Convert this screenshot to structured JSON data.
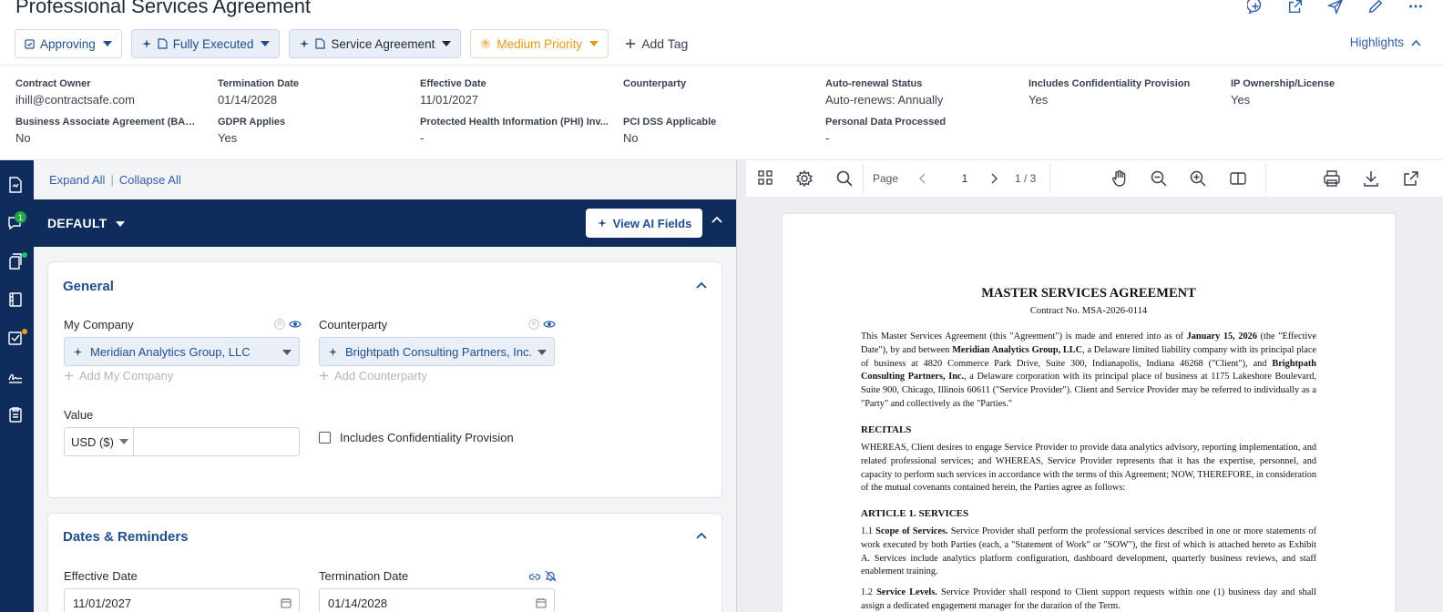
{
  "header": {
    "title": "Professional Services Agreement",
    "chips": {
      "status": "Approving",
      "execution": "Fully Executed",
      "type": "Service Agreement",
      "priority": "Medium Priority",
      "add_tag": "Add Tag"
    },
    "highlights_label": "Highlights"
  },
  "metadata": {
    "contract_owner": {
      "label": "Contract Owner",
      "value": "ihill@contractsafe.com"
    },
    "termination_date": {
      "label": "Termination Date",
      "value": "01/14/2028"
    },
    "effective_date": {
      "label": "Effective Date",
      "value": "11/01/2027"
    },
    "counterparty": {
      "label": "Counterparty",
      "value": ""
    },
    "auto_renewal": {
      "label": "Auto-renewal Status",
      "value": "Auto-renews: Annually"
    },
    "confidentiality": {
      "label": "Includes Confidentiality Provision",
      "value": "Yes"
    },
    "ip": {
      "label": "IP Ownership/License",
      "value": "Yes"
    },
    "baa": {
      "label": "Business Associate Agreement (BAA) R...",
      "value": "No"
    },
    "gdpr": {
      "label": "GDPR Applies",
      "value": "Yes"
    },
    "phi": {
      "label": "Protected Health Information (PHI) Inv...",
      "value": "-"
    },
    "pci": {
      "label": "PCI DSS Applicable",
      "value": "No"
    },
    "personal_data": {
      "label": "Personal Data Processed",
      "value": "-"
    }
  },
  "sidebar": {
    "notification_count": "1"
  },
  "left": {
    "expand_all": "Expand All",
    "separator": "|",
    "collapse_all": "Collapse All",
    "default_label": "DEFAULT",
    "view_ai_fields": "View AI Fields",
    "general": {
      "title": "General",
      "my_company_label": "My Company",
      "my_company_value": "Meridian Analytics Group, LLC",
      "add_my_company": "Add My Company",
      "counterparty_label": "Counterparty",
      "counterparty_value": "Brightpath Consulting Partners, Inc.",
      "add_counterparty": "Add Counterparty",
      "value_label": "Value",
      "currency": "USD ($)",
      "confidentiality_checkbox": "Includes Confidentiality Provision"
    },
    "dates": {
      "title": "Dates & Reminders",
      "effective_label": "Effective Date",
      "effective_value": "11/01/2027",
      "termination_label": "Termination Date",
      "termination_value": "01/14/2028"
    }
  },
  "viewer": {
    "page_label": "Page",
    "page_input": "1",
    "page_count": "1 / 3"
  },
  "document": {
    "title": "MASTER SERVICES AGREEMENT",
    "contract_no": "Contract No. MSA-2026-0114",
    "intro": {
      "p1": "This Master Services Agreement (this \"Agreement\") is made and entered into as of ",
      "date": "January 15, 2026",
      "p2": " (the \"Effective Date\"), by and between ",
      "party1": "Meridian Analytics Group, LLC",
      "p3": ", a Delaware limited liability company with its principal place of business at 4820 Commerce Park Drive, Suite 300, Indianapolis, Indiana 46268 (\"Client\"), and ",
      "party2": "Brightpath Consulting Partners, Inc.",
      "p4": ", a Delaware corporation with its principal place of business at 1175 Lakeshore Boulevard, Suite 900, Chicago, Illinois 60611 (\"Service Provider\"). Client and Service Provider may be referred to individually as a \"Party\" and collectively as the \"Parties.\""
    },
    "recitals_heading": "RECITALS",
    "recitals": "WHEREAS, Client desires to engage Service Provider to provide data analytics advisory, reporting implementation, and related professional services; and WHEREAS, Service Provider represents that it has the expertise, personnel, and capacity to perform such services in accordance with the terms of this Agreement; NOW, THEREFORE, in consideration of the mutual covenants contained herein, the Parties agree as follows:",
    "article1_heading": "ARTICLE 1. SERVICES",
    "s11_num": "1.1 ",
    "s11_title": "Scope of Services.",
    "s11_text": " Service Provider shall perform the professional services described in one or more statements of work executed by both Parties (each, a \"Statement of Work\" or \"SOW\"), the first of which is attached hereto as Exhibit A. Services include analytics platform configuration, dashboard development, quarterly business reviews, and staff enablement training.",
    "s12_num": "1.2 ",
    "s12_title": "Service Levels.",
    "s12_text": " Service Provider shall respond to Client support requests within one (1) business day and shall assign a dedicated engagement manager for the duration of the Term."
  }
}
